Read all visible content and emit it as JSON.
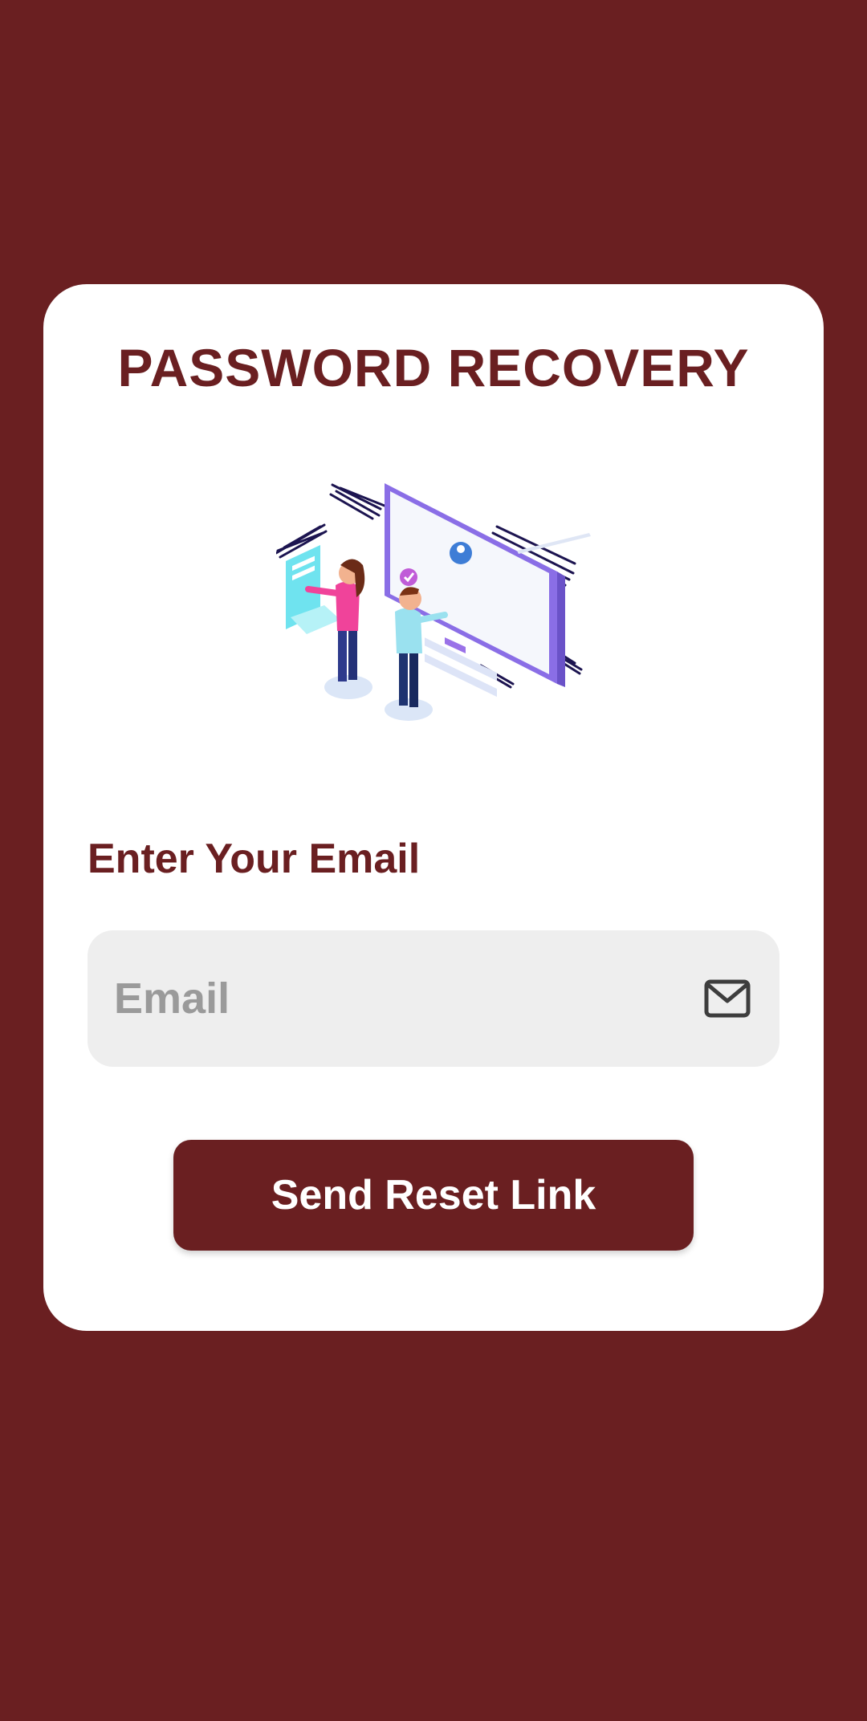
{
  "screen": {
    "title": "PASSWORD RECOVERY",
    "illustration": "password-recovery-illustration"
  },
  "form": {
    "email_label": "Enter Your Email",
    "email_placeholder": "Email",
    "email_value": "",
    "email_icon": "mail-icon",
    "submit_label": "Send Reset Link"
  },
  "colors": {
    "background": "#6a1f21",
    "card": "#ffffff",
    "accent": "#6a1f21",
    "field_background": "#eeeeee",
    "placeholder": "#9a9a9a"
  }
}
